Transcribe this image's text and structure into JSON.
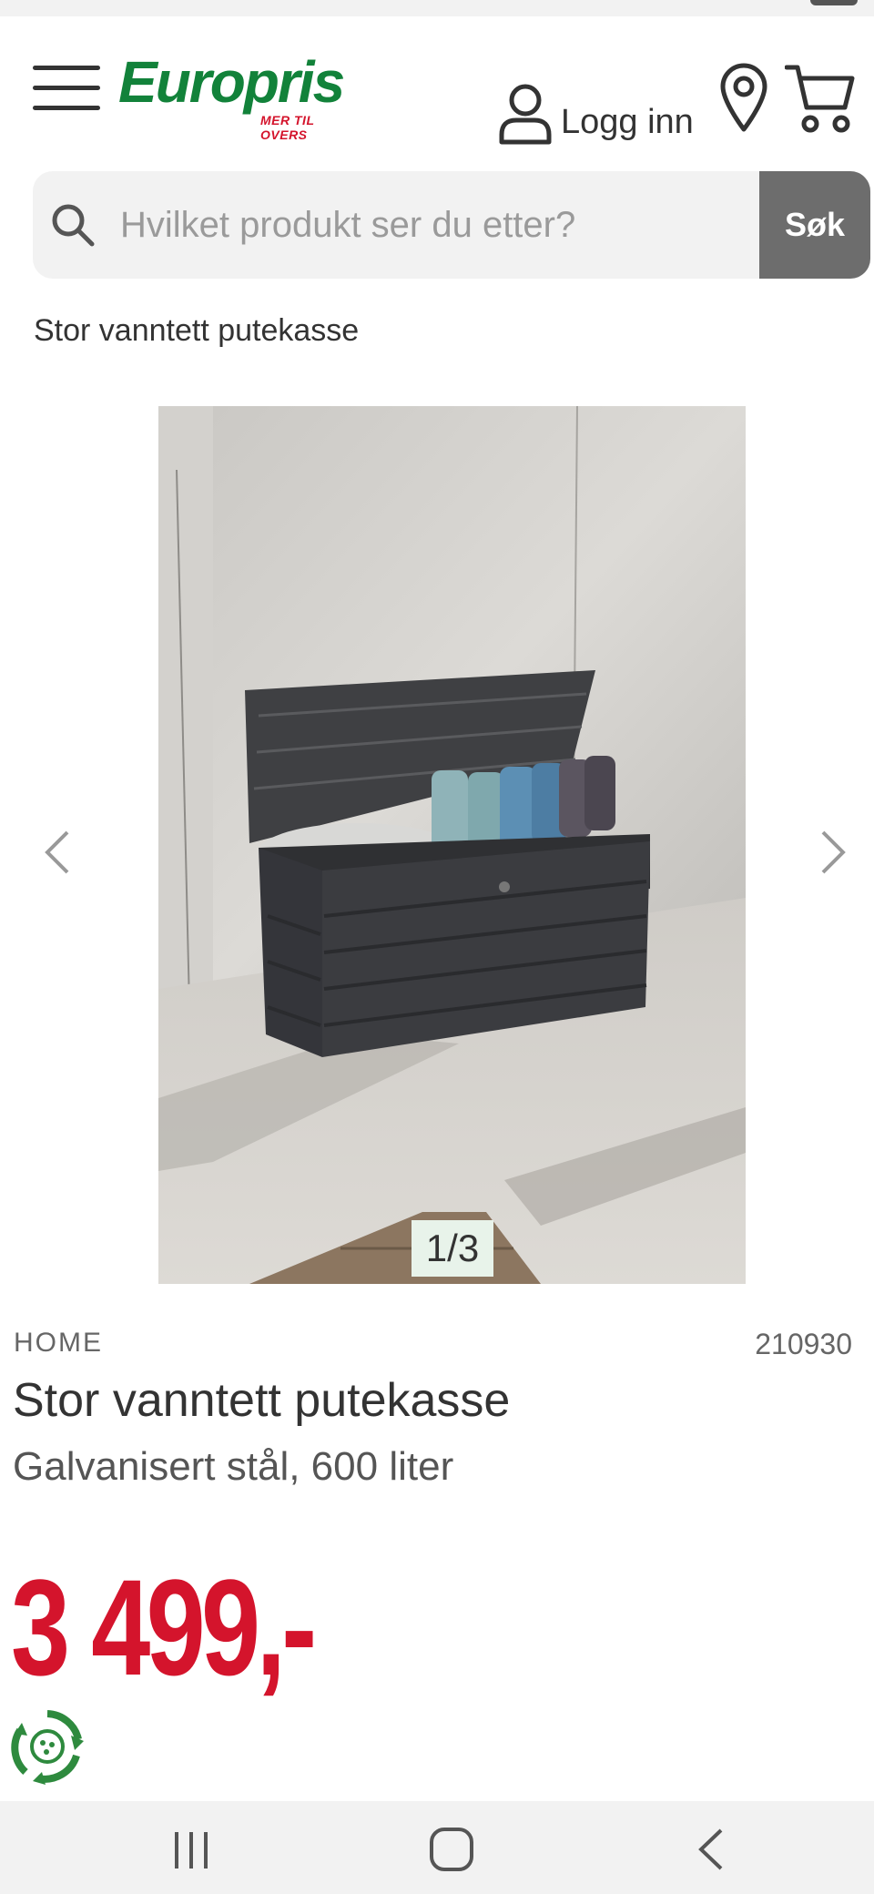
{
  "header": {
    "logo": {
      "name": "Europris",
      "tagline": "MER TIL OVERS",
      "brand_color": "#12823a",
      "accent_color": "#d4142c"
    },
    "login_label": "Logg inn",
    "icons": [
      "menu-icon",
      "user-icon",
      "location-pin-icon",
      "cart-icon"
    ]
  },
  "search": {
    "placeholder": "Hvilket produkt ser du etter?",
    "value": "",
    "button_label": "Søk"
  },
  "breadcrumb": "Stor vanntett putekasse",
  "gallery": {
    "counter": "1/3",
    "current": 1,
    "total": 3
  },
  "product": {
    "brand": "HOME",
    "sku": "210930",
    "title": "Stor vanntett putekasse",
    "subtitle": "Galvanisert stål, 600 liter",
    "price": "3 499,-",
    "price_color": "#d4142c"
  },
  "system_nav": [
    "recents-button",
    "home-button",
    "back-button"
  ]
}
